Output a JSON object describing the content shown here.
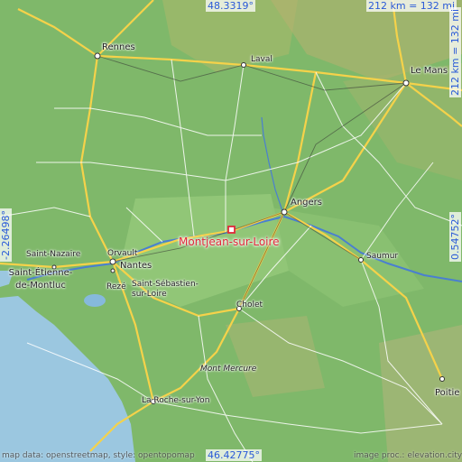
{
  "labels": {
    "top_lat": "48.3319°",
    "bottom_lat": "46.42775°",
    "left_lon": "-2.26498°",
    "right_lon": "0.54752°",
    "scale_top": "212 km = 132 mi",
    "scale_right": "212 km = 132 mi"
  },
  "cities": {
    "rennes": "Rennes",
    "laval": "Laval",
    "le_mans": "Le Mans",
    "angers": "Angers",
    "montjean": "Montjean-sur-Loire",
    "saint_nazaire": "Saint-Nazaire",
    "orvault": "Orvault",
    "nantes": "Nantes",
    "saint_etienne": "Saint-Étienne-de-Montluc",
    "reze": "Rezé",
    "saint_sebastien": "Saint-Sébastien-sur-Loire",
    "cholet": "Cholet",
    "saumur": "Saumur",
    "mont_mercure": "Mont Mercure",
    "la_roche": "La Roche-sur-Yon",
    "poitiers": "Poitie"
  },
  "attribution": {
    "left": "map data: openstreetmap, style: opentopomap",
    "right": "image proc.: elevation.city"
  },
  "colors": {
    "land": "#7fb86a",
    "sea": "#9bc7e0",
    "highway": "#f5d24a",
    "road": "#ffffff",
    "marker": "#e0283a",
    "coord_text": "#2a5ad8"
  }
}
